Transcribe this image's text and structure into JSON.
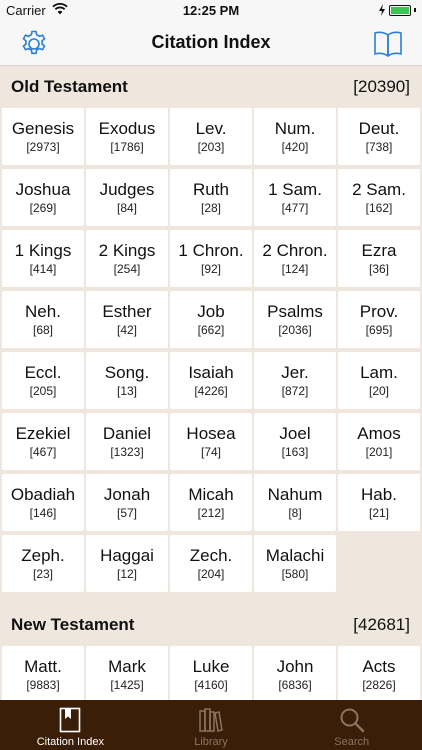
{
  "status": {
    "carrier": "Carrier",
    "time": "12:25 PM"
  },
  "nav": {
    "title": "Citation Index"
  },
  "sections": [
    {
      "title": "Old Testament",
      "count": "[20390]",
      "books": [
        {
          "name": "Genesis",
          "count": "[2973]"
        },
        {
          "name": "Exodus",
          "count": "[1786]"
        },
        {
          "name": "Lev.",
          "count": "[203]"
        },
        {
          "name": "Num.",
          "count": "[420]"
        },
        {
          "name": "Deut.",
          "count": "[738]"
        },
        {
          "name": "Joshua",
          "count": "[269]"
        },
        {
          "name": "Judges",
          "count": "[84]"
        },
        {
          "name": "Ruth",
          "count": "[28]"
        },
        {
          "name": "1 Sam.",
          "count": "[477]"
        },
        {
          "name": "2 Sam.",
          "count": "[162]"
        },
        {
          "name": "1 Kings",
          "count": "[414]"
        },
        {
          "name": "2 Kings",
          "count": "[254]"
        },
        {
          "name": "1 Chron.",
          "count": "[92]"
        },
        {
          "name": "2 Chron.",
          "count": "[124]"
        },
        {
          "name": "Ezra",
          "count": "[36]"
        },
        {
          "name": "Neh.",
          "count": "[68]"
        },
        {
          "name": "Esther",
          "count": "[42]"
        },
        {
          "name": "Job",
          "count": "[662]"
        },
        {
          "name": "Psalms",
          "count": "[2036]"
        },
        {
          "name": "Prov.",
          "count": "[695]"
        },
        {
          "name": "Eccl.",
          "count": "[205]"
        },
        {
          "name": "Song.",
          "count": "[13]"
        },
        {
          "name": "Isaiah",
          "count": "[4226]"
        },
        {
          "name": "Jer.",
          "count": "[872]"
        },
        {
          "name": "Lam.",
          "count": "[20]"
        },
        {
          "name": "Ezekiel",
          "count": "[467]"
        },
        {
          "name": "Daniel",
          "count": "[1323]"
        },
        {
          "name": "Hosea",
          "count": "[74]"
        },
        {
          "name": "Joel",
          "count": "[163]"
        },
        {
          "name": "Amos",
          "count": "[201]"
        },
        {
          "name": "Obadiah",
          "count": "[146]"
        },
        {
          "name": "Jonah",
          "count": "[57]"
        },
        {
          "name": "Micah",
          "count": "[212]"
        },
        {
          "name": "Nahum",
          "count": "[8]"
        },
        {
          "name": "Hab.",
          "count": "[21]"
        },
        {
          "name": "Zeph.",
          "count": "[23]"
        },
        {
          "name": "Haggai",
          "count": "[12]"
        },
        {
          "name": "Zech.",
          "count": "[204]"
        },
        {
          "name": "Malachi",
          "count": "[580]"
        }
      ]
    },
    {
      "title": "New Testament",
      "count": "[42681]",
      "books": [
        {
          "name": "Matt.",
          "count": "[9883]"
        },
        {
          "name": "Mark",
          "count": "[1425]"
        },
        {
          "name": "Luke",
          "count": "[4160]"
        },
        {
          "name": "John",
          "count": "[6836]"
        },
        {
          "name": "Acts",
          "count": "[2826]"
        }
      ]
    }
  ],
  "tabs": [
    {
      "label": "Citation Index",
      "icon": "bookmark-book-icon",
      "active": true
    },
    {
      "label": "Library",
      "icon": "library-books-icon",
      "active": false
    },
    {
      "label": "Search",
      "icon": "search-icon",
      "active": false
    }
  ],
  "colors": {
    "accent": "#2a7fd4",
    "tab_bar": "#3a1e08",
    "background": "#efe7dd"
  }
}
